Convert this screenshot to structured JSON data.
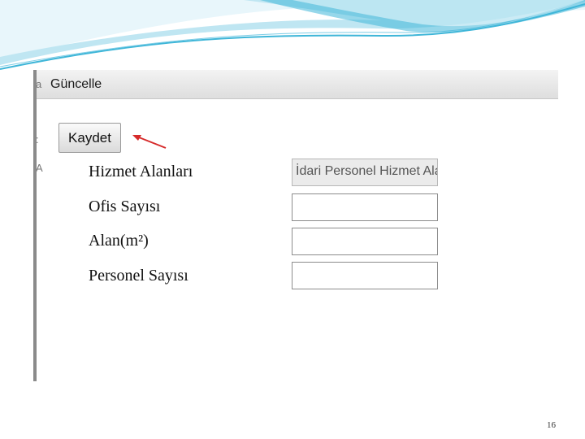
{
  "window": {
    "title": "Güncelle",
    "edge_marks": [
      "a",
      ":",
      "A"
    ]
  },
  "toolbar": {
    "save_label": "Kaydet"
  },
  "form": {
    "fields": [
      {
        "label": "Hizmet Alanları",
        "value": "İdari Personel Hizmet Ala",
        "disabled": true
      },
      {
        "label": "Ofis Sayısı",
        "value": ""
      },
      {
        "label": "Alan(m²)",
        "value": ""
      },
      {
        "label": "Personel Sayısı",
        "value": ""
      }
    ]
  },
  "slide": {
    "page_number": "16"
  },
  "colors": {
    "wave": "#3fb6d8",
    "wave_light": "#bfe6f2",
    "arrow": "#d62b2b"
  }
}
